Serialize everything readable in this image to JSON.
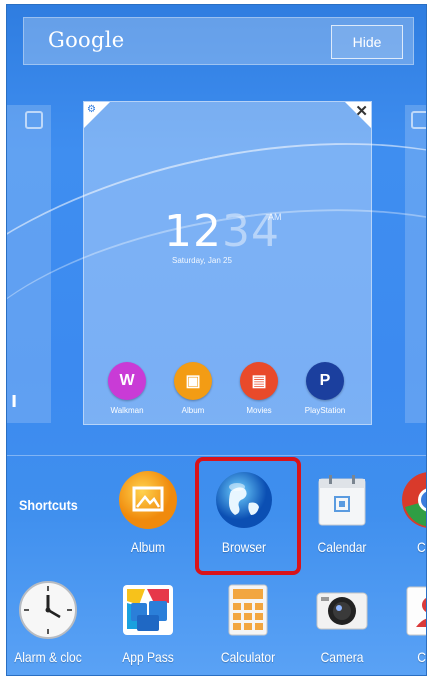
{
  "search_bar": {
    "label": "Google",
    "hide_button": "Hide"
  },
  "widget": {
    "time_main": "12",
    "time_faded": "34",
    "am_pm": "AM",
    "date": "Saturday, Jan 25",
    "apps": [
      {
        "label": "Walkman",
        "color": "#c93bd6",
        "glyph": "W"
      },
      {
        "label": "Album",
        "color": "#f39c14",
        "glyph": "▣"
      },
      {
        "label": "Movies",
        "color": "#e94a2a",
        "glyph": "▤"
      },
      {
        "label": "PlayStation",
        "color": "#1b3f9e",
        "glyph": "P"
      }
    ]
  },
  "left_pane": {
    "fragment": "ı"
  },
  "dock": {
    "shortcuts_label": "Shortcuts",
    "row1": [
      {
        "label": "Album",
        "icon": "album-icon"
      },
      {
        "label": "Browser",
        "icon": "globe-icon"
      },
      {
        "label": "Calendar",
        "icon": "calendar-icon"
      },
      {
        "label": "Chro",
        "icon": "chrome-icon"
      }
    ],
    "row2": [
      {
        "label": "Alarm & cloc",
        "icon": "clock-icon"
      },
      {
        "label": "App Pass",
        "icon": "app-pass-icon"
      },
      {
        "label": "Calculator",
        "icon": "calculator-icon"
      },
      {
        "label": "Camera",
        "icon": "camera-icon"
      },
      {
        "label": "Cont",
        "icon": "contacts-icon"
      }
    ],
    "highlight_color": "#d8131a"
  }
}
